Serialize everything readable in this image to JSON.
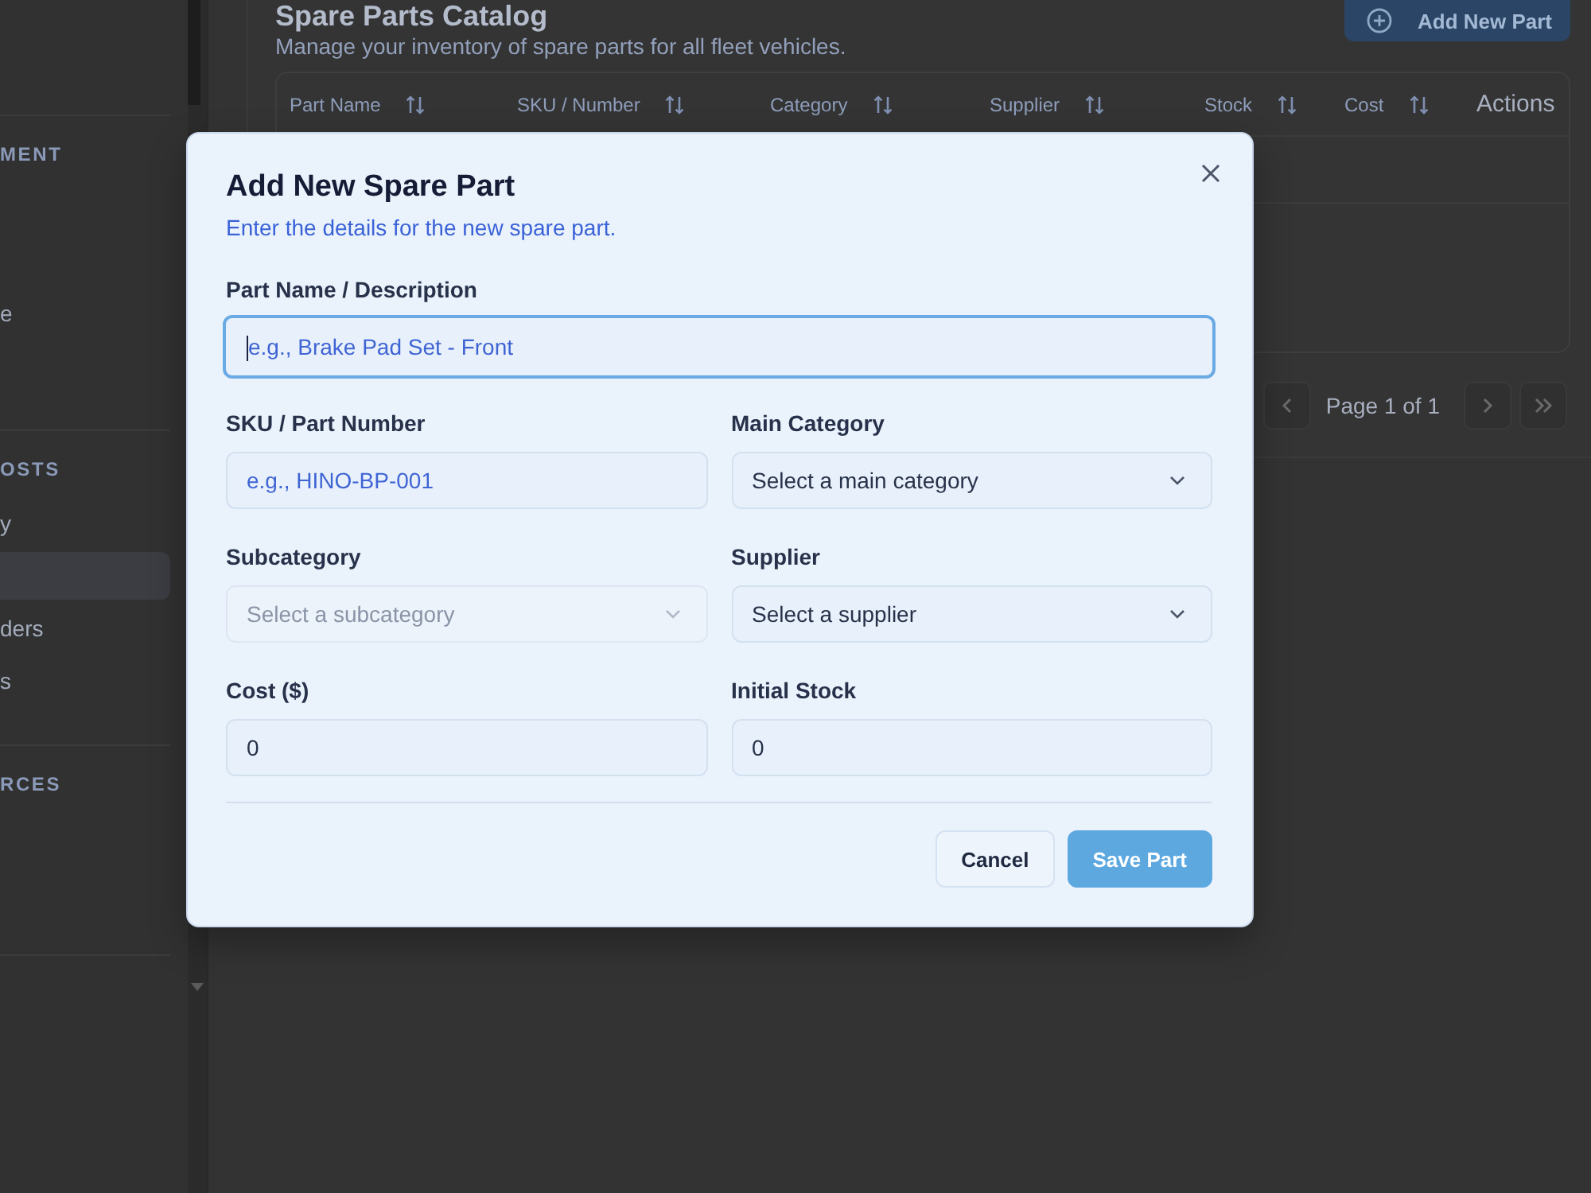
{
  "sidebar": {
    "sections": [
      {
        "heading": "MENT",
        "items": [
          {
            "selected": false
          },
          {
            "selected": false
          },
          {
            "label": "e",
            "selected": false
          },
          {
            "selected": false
          }
        ]
      },
      {
        "heading": "OSTS",
        "items": [
          {
            "label": "y",
            "selected": false
          },
          {
            "selected": true
          },
          {
            "label": "ders",
            "selected": false
          },
          {
            "label": "s",
            "selected": false
          }
        ]
      },
      {
        "heading": "RCES",
        "items": [
          {
            "selected": false
          },
          {
            "selected": false
          }
        ]
      }
    ]
  },
  "page": {
    "title": "Spare Parts Catalog",
    "subtitle": "Manage your inventory of spare parts for all fleet vehicles.",
    "add_button": "Add New Part"
  },
  "table": {
    "columns": [
      {
        "label": "Part Name",
        "sortable": true
      },
      {
        "label": "SKU / Number",
        "sortable": true
      },
      {
        "label": "Category",
        "sortable": true
      },
      {
        "label": "Supplier",
        "sortable": true
      },
      {
        "label": "Stock",
        "sortable": true
      },
      {
        "label": "Cost",
        "sortable": true
      },
      {
        "label": "Actions",
        "sortable": false
      }
    ]
  },
  "pagination": {
    "label": "Page 1 of 1"
  },
  "dialog": {
    "title": "Add New Spare Part",
    "subtitle": "Enter the details for the new spare part.",
    "field_rows": [
      [
        {
          "kind": "input",
          "label": "Part Name / Description",
          "placeholder": "e.g., Brake Pad Set - Front",
          "focused": true,
          "disabled": false
        }
      ],
      [
        {
          "kind": "input",
          "label": "SKU / Part Number",
          "placeholder": "e.g., HINO-BP-001",
          "focused": false,
          "disabled": false
        },
        {
          "kind": "select",
          "label": "Main Category",
          "placeholder": "Select a main category",
          "focused": false,
          "disabled": false
        }
      ],
      [
        {
          "kind": "select",
          "label": "Subcategory",
          "placeholder": "Select a subcategory",
          "focused": false,
          "disabled": true
        },
        {
          "kind": "select",
          "label": "Supplier",
          "placeholder": "Select a supplier",
          "focused": false,
          "disabled": false
        }
      ],
      [
        {
          "kind": "input",
          "label": "Cost ($)",
          "value": "0",
          "focused": false,
          "disabled": false
        },
        {
          "kind": "input",
          "label": "Initial Stock",
          "value": "0",
          "focused": false,
          "disabled": false
        }
      ]
    ],
    "buttons": [
      {
        "label": "Cancel",
        "kind": "secondary"
      },
      {
        "label": "Save Part",
        "kind": "primary"
      }
    ]
  }
}
